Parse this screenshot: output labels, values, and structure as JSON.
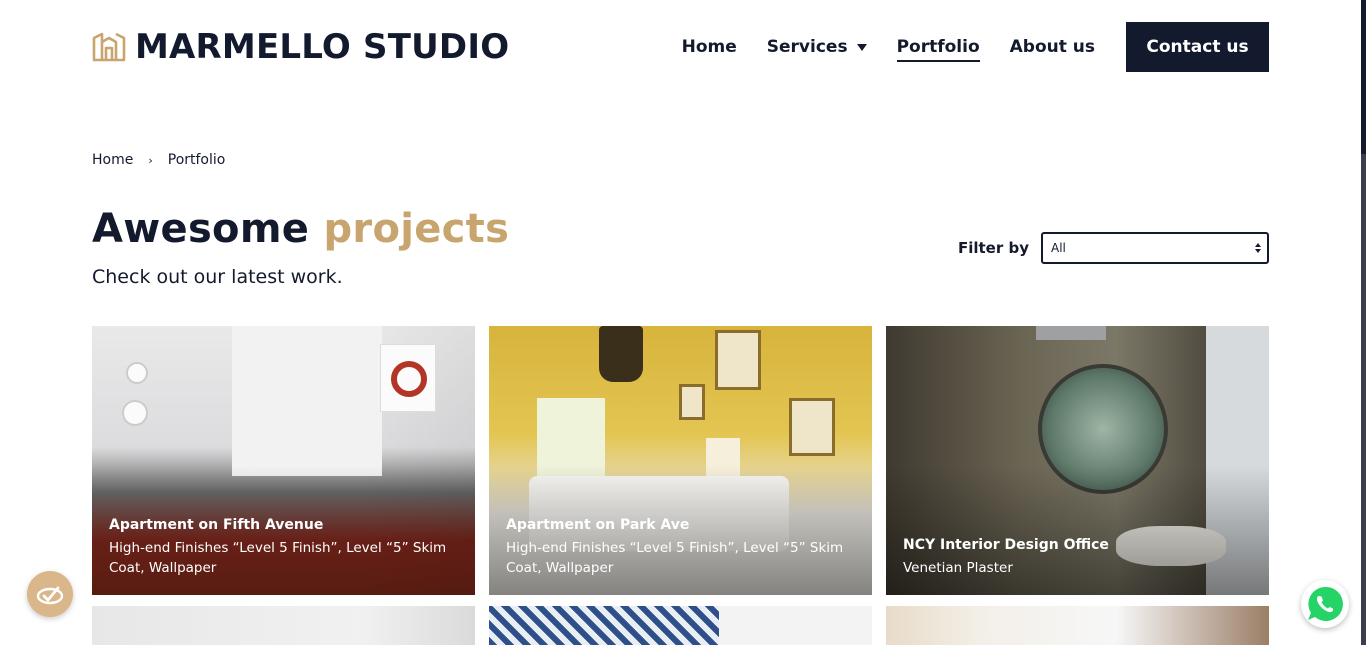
{
  "brand": {
    "name": "MARMELLO STUDIO",
    "logo_color": "#c8a46e"
  },
  "nav": {
    "items": [
      {
        "label": "Home"
      },
      {
        "label": "Services"
      },
      {
        "label": "Portfolio"
      },
      {
        "label": "About us"
      }
    ],
    "contact_label": "Contact us",
    "active": "Portfolio"
  },
  "breadcrumb": {
    "items": [
      "Home",
      "Portfolio"
    ]
  },
  "page": {
    "title_part1": "Awesome",
    "title_part2": "projects",
    "subtitle": "Check out our latest work.",
    "accent_color": "#c8a46e",
    "dark_color": "#141a2e"
  },
  "filter": {
    "label": "Filter by",
    "selected": "All"
  },
  "projects": [
    {
      "title": "Apartment on Fifth Avenue",
      "description": "High-end Finishes “Level 5 Finish”, Level “5” Skim Coat, Wallpaper"
    },
    {
      "title": "Apartment on Park Ave",
      "description": "High-end Finishes “Level 5 Finish”, Level “5” Skim Coat, Wallpaper"
    },
    {
      "title": "NCY Interior Design Office",
      "description": "Venetian Plaster"
    }
  ],
  "floating": {
    "left_icon": "cookie-settings-icon",
    "right_icon": "whatsapp-icon",
    "whatsapp_color": "#25d366"
  }
}
